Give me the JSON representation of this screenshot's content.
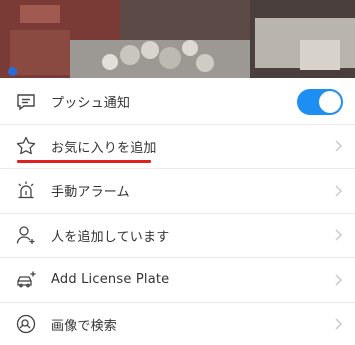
{
  "camera": {
    "preview_icon": "camera-feed"
  },
  "menu": {
    "items": [
      {
        "label": "プッシュ通知",
        "icon": "message-square-icon",
        "control": "toggle",
        "toggle_on": true
      },
      {
        "label": "お気に入りを追加",
        "icon": "star-icon",
        "control": "chevron",
        "highlighted": true
      },
      {
        "label": "手動アラーム",
        "icon": "alarm-bell-icon",
        "control": "chevron"
      },
      {
        "label": "人を追加しています",
        "icon": "person-add-icon",
        "control": "chevron"
      },
      {
        "label": "Add License Plate",
        "icon": "car-add-icon",
        "control": "chevron"
      },
      {
        "label": "画像で検索",
        "icon": "image-search-icon",
        "control": "chevron"
      }
    ]
  },
  "colors": {
    "accent": "#1d8ff2",
    "highlight_underline": "#e02020"
  }
}
